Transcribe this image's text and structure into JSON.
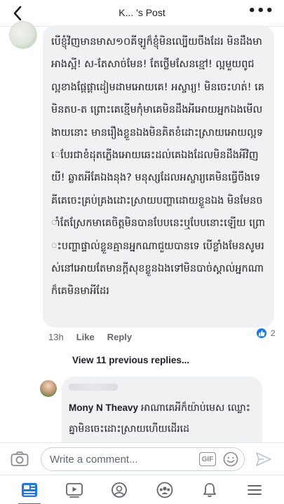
{
  "header": {
    "title": "K... 's Post",
    "back_icon": "chevron-left-icon",
    "more_icon": "more-horizontal-icon"
  },
  "comment": {
    "text": "បើខ្ញុំវិញមានមាស១០គីឡូក៏ខ្ញុំមិនល្បើយចឹងដែរ មិនដឹងមាអាងស្អី! ស-តែសាច់មែន! តែថ្លើមសែនខ្មៅ! ល្អមួយពូជ ល្អខាងផ្ដែផ្ដាដៀមដាមអោយគេ! អស្ចារ្យ! មិនចេះហត់! គេមិនតប-ត ព្រោះគេខ្មើមកុំមាគេមិនដឹងអីអោយអ្នកឯងមើលងាយនោះ មានរឿងខ្លួនឯងមិនគិតខំដោះស្រាយអោយល្អទេបែរជាខំដុតភ្លើងអោយឆេះដល់គេឯងដែលមិនដឹងអីវិញ យី! ឆ្លាតអីគែឯងនុង? មនុស្សដែលអស្ចារ្យគេមិនធ្វើចឹងទេគីគេចេះគ្រប់គ្រងដោះស្រាយបញ្ហាដោយខ្លួនឯង មិនមែនចាំតែស្រែកមាគេចិត្តមិនបានបែបនេះឬបែបនោះឡើយ ព្រោះបញ្ហាផ្ទាល់ខ្លួនគ្មានអ្នកណាជួយបានទេ បើខ្លាំងមែនសូមរស់នៅអោយតែមានក្ដីសុខខ្លួនឯងទៅមិនបាច់ស្គាល់អ្នកណាក៏គេមិនមាអីដែរ",
    "time": "13h",
    "like_label": "Like",
    "reply_label": "Reply",
    "reaction_count": "2",
    "reaction_icon": "like-icon"
  },
  "replies": {
    "view_previous": "View 11 previous replies...",
    "reply": {
      "author": "Mony N Theavy",
      "text": "អាណាគេអីក៏យ៉ាប់មេស ឈ្លោះគ្នាមិនចេះដោះស្រាយហើយដើរដេ"
    }
  },
  "composer": {
    "placeholder": "Write a comment...",
    "gif_label": "GIF",
    "camera_icon": "camera-icon",
    "emoji_icon": "emoji-icon",
    "send_icon": "send-icon"
  },
  "bottom_nav": {
    "items": [
      "news-feed-icon",
      "watch-icon",
      "profile-icon",
      "groups-icon",
      "notifications-icon",
      "menu-icon"
    ],
    "active": "news-feed-icon",
    "accent": "#1877f2"
  }
}
